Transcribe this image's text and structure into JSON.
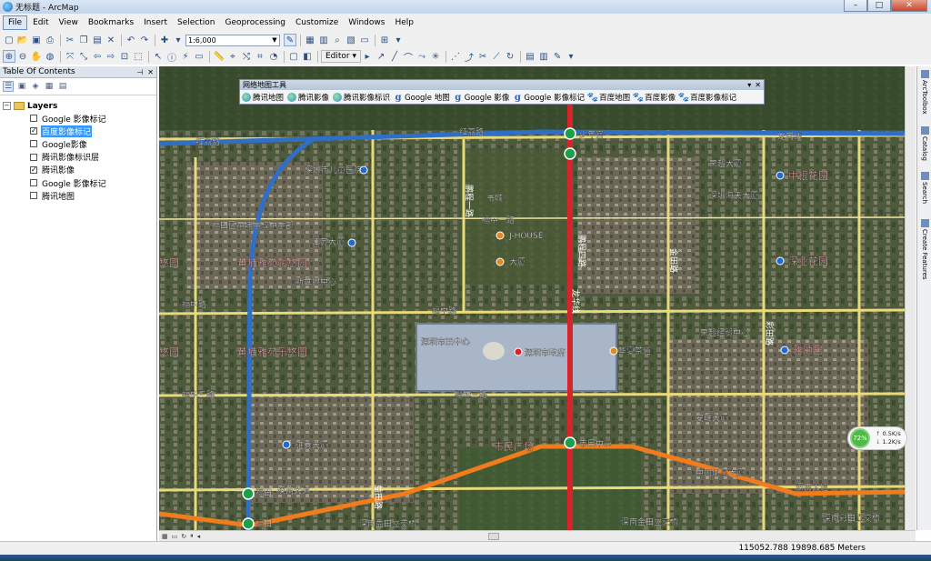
{
  "window": {
    "title": "无标题 - ArcMap",
    "controls": [
      "–",
      "□",
      "✕"
    ]
  },
  "menu": [
    {
      "label": "File",
      "active": true
    },
    {
      "label": "Edit"
    },
    {
      "label": "View"
    },
    {
      "label": "Bookmarks"
    },
    {
      "label": "Insert"
    },
    {
      "label": "Selection"
    },
    {
      "label": "Geoprocessing"
    },
    {
      "label": "Customize"
    },
    {
      "label": "Windows"
    },
    {
      "label": "Help"
    }
  ],
  "toolbar": {
    "scale": "1:6,000",
    "editor_label": "Editor ▾"
  },
  "toc": {
    "title": "Table Of Contents",
    "root_label": "Layers",
    "layers": [
      {
        "label": "Google 影像标记",
        "checked": false,
        "selected": false
      },
      {
        "label": "百度影像标记",
        "checked": true,
        "selected": true
      },
      {
        "label": "Google影像",
        "checked": false,
        "selected": false
      },
      {
        "label": "腾讯影像标识层",
        "checked": false,
        "selected": false
      },
      {
        "label": "腾讯影像",
        "checked": true,
        "selected": false
      },
      {
        "label": "Google 影像标记",
        "checked": false,
        "selected": false
      },
      {
        "label": "腾讯地图",
        "checked": false,
        "selected": false
      }
    ]
  },
  "float_window": {
    "title": "网络地图工具",
    "buttons": [
      {
        "label": "腾讯地图",
        "icon": "tencent-icon"
      },
      {
        "label": "腾讯影像",
        "icon": "tencent-icon"
      },
      {
        "label": "腾讯影像标识",
        "icon": "tencent-icon"
      },
      {
        "label": "Google 地图",
        "icon": "google-icon"
      },
      {
        "label": "Google 影像",
        "icon": "google-icon"
      },
      {
        "label": "Google 影像标记",
        "icon": "google-icon"
      },
      {
        "label": "百度地图",
        "icon": "baidu-icon"
      },
      {
        "label": "百度影像",
        "icon": "baidu-icon"
      },
      {
        "label": "百度影像标记",
        "icon": "baidu-icon"
      }
    ]
  },
  "right_dock": [
    "ArcToolbox",
    "Catalog",
    "Search",
    "Create Features"
  ],
  "status": {
    "coordinates": "115052.788   19898.685 Meters"
  },
  "network": {
    "percent": "72%",
    "upload": "0.5K/s",
    "download": "1.2K/s"
  },
  "map_labels": {
    "road_honglilu_w": "红荔路",
    "road_honglilu_e": "红荔路",
    "line_longgang_top": "龙岗线",
    "station_shaoniangong": "少年宫",
    "poi_children_hospital": "深圳市儿童医院",
    "poi_futian_school": "福田区黄埔学校中学部",
    "poi_jiangsu": "江苏大厦",
    "poi_huangpu_junyue": "黄埔雅苑骏悠园",
    "poi_xinshijie": "新世界中心",
    "poi_huangpu_leyue": "黄埔雅苑乐悠园",
    "road_fuzhonglu": "福中路",
    "road_fuzhonglu_w": "福中路",
    "road_fuzhong3": "福中三路",
    "road_fuzhong3_e": "福中三路",
    "poi_bookcity": "书城",
    "poi_jhouse": "J-HOUSE",
    "poi_dahuiyuan": "大厦",
    "poi_shenzhen_gov": "深圳市政府",
    "poi_citizen_plaza": "市民广场",
    "station_shiminzhongxin": "市民中心",
    "poi_zhongyin": "中银花园",
    "poi_shenye": "深业花园",
    "poi_yasong": "雅颂居",
    "road_shennan": "深南大道",
    "road_shennan_e": "深南大道",
    "poi_jinzhong": "深南金田立交桥",
    "poi_caitian": "深南彩田立交桥",
    "poi_yiyi": "深南益田立交桥",
    "station_futian": "福田",
    "road_futian": "福田",
    "road_pengcheng4": "鹏程四路",
    "road_yitianlu": "益田路",
    "road_fuzhong1": "福中一路",
    "line_longhua": "龙华线",
    "poi_youyiyuan": "悠园",
    "poi_youyiyuan2": "悠园",
    "road_jintian": "金田路",
    "road_caitian": "彩田路",
    "road_pengcheng": "鹏程一路",
    "poi_securities": "证券大厦",
    "poi_anlian": "安联大厦",
    "poi_fenghuang": "中国凤凰大厦",
    "poi_huaxia": "华夏茶道",
    "poi_yecheng": "荣超经贸中心",
    "poi_jingle": "深圳市民中心",
    "poi_rongchao": "荣超大厦",
    "poi_haitian": "深圳海天大厦"
  }
}
